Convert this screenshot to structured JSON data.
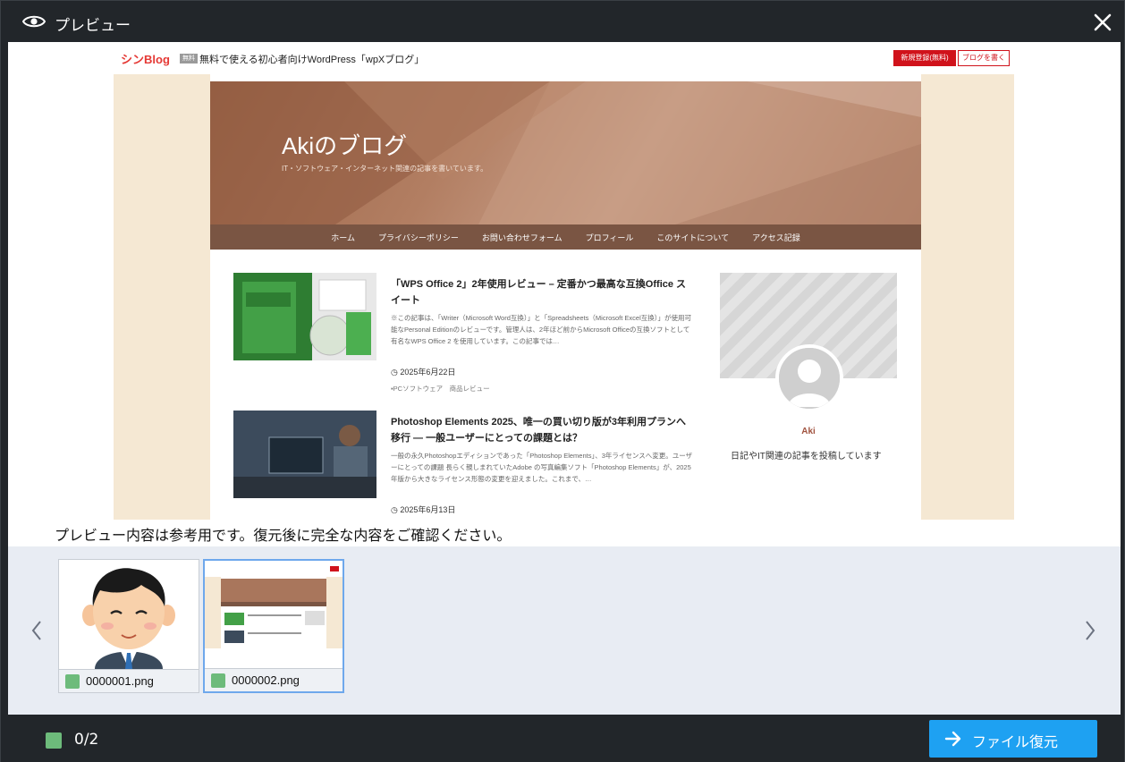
{
  "window": {
    "title": "プレビュー",
    "title_icon": "eye-icon",
    "close_icon": "close-icon"
  },
  "preview": {
    "blog_site": {
      "brand": "シンBlog",
      "free_tag": "無料",
      "tagline": "無料で使える初心者向けWordPress「wpXブログ」",
      "signup_button": "新規登録(無料)",
      "write_button": "ブログを書く"
    },
    "blog": {
      "title": "Akiのブログ",
      "description": "IT・ソフトウェア・インターネット関連の記事を書いています。",
      "nav": [
        "ホーム",
        "プライバシーポリシー",
        "お問い合わせフォーム",
        "プロフィール",
        "このサイトについて",
        "アクセス記録"
      ]
    },
    "posts": [
      {
        "title": "「WPS Office 2」2年使用レビュー – 定番かつ最高な互換Office スイート",
        "excerpt": "※この記事は、「Writer（Microsoft Word互換）」と「Spreadsheets（Microsoft Excel互換）」が使用可能なPersonal Editionのレビューです。管理人は、2年ほど前からMicrosoft Officeの互換ソフトとして有名なWPS Office 2 を使用しています。この記事では…",
        "date": "2025年6月22日",
        "categories": "PCソフトウェア　商品レビュー"
      },
      {
        "title": "Photoshop Elements 2025、唯一の買い切り版が3年利用プランへ移行 — 一般ユーザーにとっての課題とは？",
        "excerpt": "一般の永久Photoshopエディションであった「Photoshop Elements」、3年ライセンスへ変更。ユーザーにとっての課題 長らく親しまれていたAdobe の写真編集ソフト「Photoshop Elements」が、2025年版から大きなライセンス形態の変更を迎えました。これまで、…",
        "date": "2025年6月13日"
      }
    ],
    "sidebar": {
      "name": "Aki",
      "profile_text": "日記やIT関連の記事を投稿しています"
    },
    "notice": "プレビュー内容は参考用です。復元後に完全な内容をご確認ください。"
  },
  "thumbnails": [
    {
      "filename": "0000001.png",
      "selected": false
    },
    {
      "filename": "0000002.png",
      "selected": true
    }
  ],
  "nav_icons": {
    "prev": "chevron-left-icon",
    "next": "chevron-right-icon"
  },
  "footer": {
    "selected_count": "0/2",
    "restore_button": "ファイル復元",
    "restore_icon": "arrow-right-icon"
  },
  "colors": {
    "accent": "#1ea1f2",
    "check": "#6dbb7b",
    "chrome": "#22262a",
    "strip": "#e8ecf3"
  }
}
